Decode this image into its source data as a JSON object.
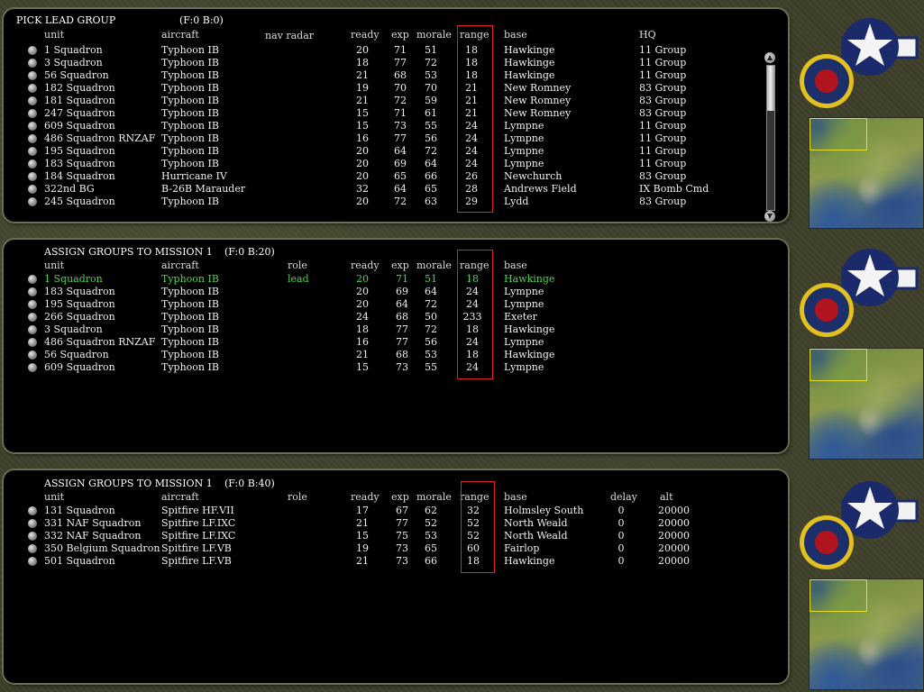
{
  "panel1": {
    "title": "PICK LEAD GROUP",
    "counter": "(F:0 B:0)",
    "headers": {
      "unit": "unit",
      "aircraft": "aircraft",
      "navradar": "nav radar",
      "ready": "ready",
      "exp": "exp",
      "morale": "morale",
      "range": "range",
      "base": "base",
      "hq": "HQ"
    },
    "rows": [
      {
        "unit": "1 Squadron",
        "aircraft": "Typhoon IB",
        "ready": "20",
        "exp": "71",
        "morale": "51",
        "range": "18",
        "base": "Hawkinge",
        "hq": "11 Group"
      },
      {
        "unit": "3 Squadron",
        "aircraft": "Typhoon IB",
        "ready": "18",
        "exp": "77",
        "morale": "72",
        "range": "18",
        "base": "Hawkinge",
        "hq": "11 Group"
      },
      {
        "unit": "56 Squadron",
        "aircraft": "Typhoon IB",
        "ready": "21",
        "exp": "68",
        "morale": "53",
        "range": "18",
        "base": "Hawkinge",
        "hq": "11 Group"
      },
      {
        "unit": "182 Squadron",
        "aircraft": "Typhoon IB",
        "ready": "19",
        "exp": "70",
        "morale": "70",
        "range": "21",
        "base": "New Romney",
        "hq": "83 Group"
      },
      {
        "unit": "181 Squadron",
        "aircraft": "Typhoon IB",
        "ready": "21",
        "exp": "72",
        "morale": "59",
        "range": "21",
        "base": "New Romney",
        "hq": "83 Group"
      },
      {
        "unit": "247 Squadron",
        "aircraft": "Typhoon IB",
        "ready": "15",
        "exp": "71",
        "morale": "61",
        "range": "21",
        "base": "New Romney",
        "hq": "83 Group"
      },
      {
        "unit": "609 Squadron",
        "aircraft": "Typhoon IB",
        "ready": "15",
        "exp": "73",
        "morale": "55",
        "range": "24",
        "base": "Lympne",
        "hq": "11 Group"
      },
      {
        "unit": "486 Squadron RNZAF",
        "aircraft": "Typhoon IB",
        "ready": "16",
        "exp": "77",
        "morale": "56",
        "range": "24",
        "base": "Lympne",
        "hq": "11 Group"
      },
      {
        "unit": "195 Squadron",
        "aircraft": "Typhoon IB",
        "ready": "20",
        "exp": "64",
        "morale": "72",
        "range": "24",
        "base": "Lympne",
        "hq": "11 Group"
      },
      {
        "unit": "183 Squadron",
        "aircraft": "Typhoon IB",
        "ready": "20",
        "exp": "69",
        "morale": "64",
        "range": "24",
        "base": "Lympne",
        "hq": "11 Group"
      },
      {
        "unit": "184 Squadron",
        "aircraft": "Hurricane IV",
        "ready": "20",
        "exp": "65",
        "morale": "66",
        "range": "26",
        "base": "Newchurch",
        "hq": "83 Group"
      },
      {
        "unit": "322nd BG",
        "aircraft": "B-26B Marauder",
        "ready": "32",
        "exp": "64",
        "morale": "65",
        "range": "28",
        "base": "Andrews Field",
        "hq": "IX Bomb Cmd"
      },
      {
        "unit": "245 Squadron",
        "aircraft": "Typhoon IB",
        "ready": "20",
        "exp": "72",
        "morale": "63",
        "range": "29",
        "base": "Lydd",
        "hq": "83 Group"
      }
    ]
  },
  "panel2": {
    "title": "ASSIGN GROUPS TO MISSION 1",
    "counter": "(F:0 B:20)",
    "headers": {
      "unit": "unit",
      "aircraft": "aircraft",
      "role": "role",
      "ready": "ready",
      "exp": "exp",
      "morale": "morale",
      "range": "range",
      "base": "base"
    },
    "rows": [
      {
        "unit": "1 Squadron",
        "aircraft": "Typhoon IB",
        "role": "lead",
        "ready": "20",
        "exp": "71",
        "morale": "51",
        "range": "18",
        "base": "Hawkinge",
        "lead": true
      },
      {
        "unit": "183 Squadron",
        "aircraft": "Typhoon IB",
        "role": "",
        "ready": "20",
        "exp": "69",
        "morale": "64",
        "range": "24",
        "base": "Lympne"
      },
      {
        "unit": "195 Squadron",
        "aircraft": "Typhoon IB",
        "role": "",
        "ready": "20",
        "exp": "64",
        "morale": "72",
        "range": "24",
        "base": "Lympne"
      },
      {
        "unit": "266 Squadron",
        "aircraft": "Typhoon IB",
        "role": "",
        "ready": "24",
        "exp": "68",
        "morale": "50",
        "range": "233",
        "base": "Exeter"
      },
      {
        "unit": "3 Squadron",
        "aircraft": "Typhoon IB",
        "role": "",
        "ready": "18",
        "exp": "77",
        "morale": "72",
        "range": "18",
        "base": "Hawkinge"
      },
      {
        "unit": "486 Squadron RNZAF",
        "aircraft": "Typhoon IB",
        "role": "",
        "ready": "16",
        "exp": "77",
        "morale": "56",
        "range": "24",
        "base": "Lympne"
      },
      {
        "unit": "56 Squadron",
        "aircraft": "Typhoon IB",
        "role": "",
        "ready": "21",
        "exp": "68",
        "morale": "53",
        "range": "18",
        "base": "Hawkinge"
      },
      {
        "unit": "609 Squadron",
        "aircraft": "Typhoon IB",
        "role": "",
        "ready": "15",
        "exp": "73",
        "morale": "55",
        "range": "24",
        "base": "Lympne"
      }
    ]
  },
  "panel3": {
    "title": "ASSIGN GROUPS TO MISSION 1",
    "counter": "(F:0 B:40)",
    "headers": {
      "unit": "unit",
      "aircraft": "aircraft",
      "role": "role",
      "ready": "ready",
      "exp": "exp",
      "morale": "morale",
      "range": "range",
      "base": "base",
      "delay": "delay",
      "alt": "alt"
    },
    "rows": [
      {
        "unit": "131 Squadron",
        "aircraft": "Spitfire HF.VII",
        "ready": "17",
        "exp": "67",
        "morale": "62",
        "range": "32",
        "base": "Holmsley South",
        "delay": "0",
        "alt": "20000"
      },
      {
        "unit": "331 NAF Squadron",
        "aircraft": "Spitfire LF.IXC",
        "ready": "21",
        "exp": "77",
        "morale": "52",
        "range": "52",
        "base": "North Weald",
        "delay": "0",
        "alt": "20000"
      },
      {
        "unit": "332 NAF Squadron",
        "aircraft": "Spitfire LF.IXC",
        "ready": "15",
        "exp": "75",
        "morale": "53",
        "range": "52",
        "base": "North Weald",
        "delay": "0",
        "alt": "20000"
      },
      {
        "unit": "350 Belgium Squadron",
        "aircraft": "Spitfire LF.VB",
        "ready": "19",
        "exp": "73",
        "morale": "65",
        "range": "60",
        "base": "Fairlop",
        "delay": "0",
        "alt": "20000"
      },
      {
        "unit": "501 Squadron",
        "aircraft": "Spitfire LF.VB",
        "ready": "21",
        "exp": "73",
        "morale": "66",
        "range": "18",
        "base": "Hawkinge",
        "delay": "0",
        "alt": "20000"
      }
    ]
  },
  "colors": {
    "lead": "#4fd44f",
    "range_box": "#dd2222",
    "panel_bg": "#000000",
    "camo_bg": "#3d3f2a"
  },
  "icons": {
    "usaaf": "usaaf-star-insignia-icon",
    "raf": "raf-roundel-icon",
    "map": "europe-minimap"
  }
}
